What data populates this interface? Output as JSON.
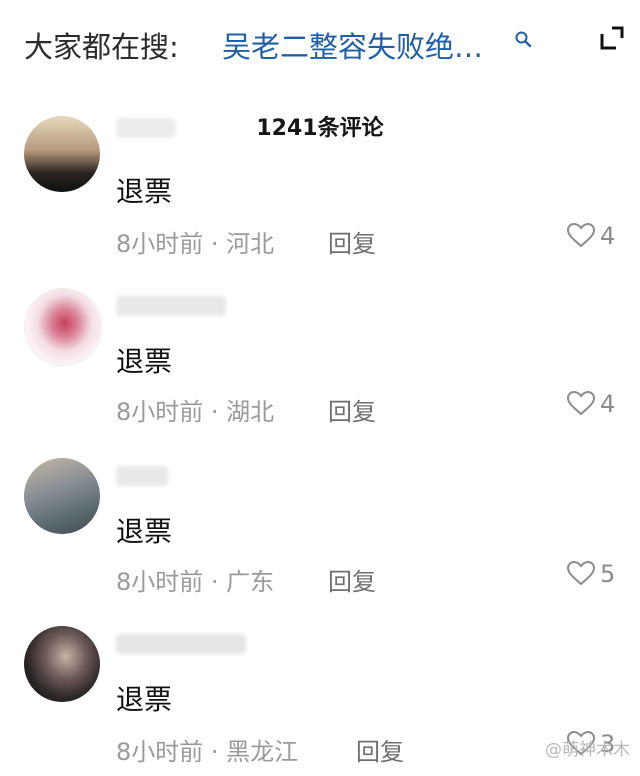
{
  "header": {
    "hot_label": "大家都在搜:",
    "hot_query": "吴老二整容失败绝…"
  },
  "comments_count": "1241条评论",
  "comments": [
    {
      "text": "退票",
      "time": "8小时前",
      "location": "河北",
      "reply_label": "回复",
      "likes": "4"
    },
    {
      "text": "退票",
      "time": "8小时前",
      "location": "湖北",
      "reply_label": "回复",
      "likes": "4"
    },
    {
      "text": "退票",
      "time": "8小时前",
      "location": "广东",
      "reply_label": "回复",
      "likes": "5"
    },
    {
      "text": "退票",
      "time": "8小时前",
      "location": "黑龙江",
      "reply_label": "回复",
      "likes": "3"
    }
  ],
  "watermark": "@萌神木木",
  "colors": {
    "link": "#1f5fa8",
    "meta": "#9a9a9a"
  }
}
